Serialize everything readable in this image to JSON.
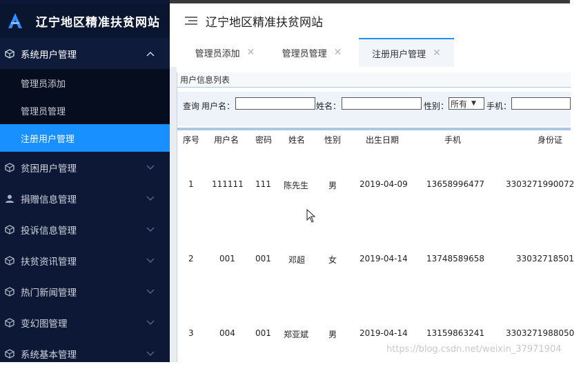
{
  "app": {
    "brand_title": "辽宁地区精准扶贫网站",
    "header_title": "辽宁地区精准扶贫网站"
  },
  "sidebar": {
    "groups": [
      {
        "label": "系统用户管理",
        "icon": "cube-icon",
        "state": "expanded"
      },
      {
        "label": "贫困用户管理",
        "icon": "cube-icon",
        "state": "collapsed"
      },
      {
        "label": "捐赠信息管理",
        "icon": "user-icon",
        "state": "collapsed"
      },
      {
        "label": "投诉信息管理",
        "icon": "cube-icon",
        "state": "collapsed"
      },
      {
        "label": "扶贫资讯管理",
        "icon": "cube-icon",
        "state": "collapsed"
      },
      {
        "label": "热门新闻管理",
        "icon": "cube-icon",
        "state": "collapsed"
      },
      {
        "label": "变幻图管理",
        "icon": "cube-icon",
        "state": "collapsed"
      },
      {
        "label": "系统基本管理",
        "icon": "cube-icon",
        "state": "collapsed"
      }
    ],
    "sub_items": [
      {
        "label": "管理员添加",
        "active": false
      },
      {
        "label": "管理员管理",
        "active": false
      },
      {
        "label": "注册用户管理",
        "active": true
      }
    ]
  },
  "tabs": [
    {
      "label": "管理员添加",
      "close": "✕",
      "active": false
    },
    {
      "label": "管理员管理",
      "close": "✕",
      "active": false
    },
    {
      "label": "注册用户管理",
      "close": "✕",
      "active": true
    }
  ],
  "panel": {
    "title": "用户信息列表",
    "search": {
      "query_label": "查询",
      "username_label": "用户名：",
      "username_value": "",
      "name_label": "姓名：",
      "name_value": "",
      "gender_label": "性别：",
      "gender_selected": "所有",
      "phone_label": "手机：",
      "phone_value": ""
    }
  },
  "table": {
    "columns": [
      "序号",
      "用户名",
      "密码",
      "姓名",
      "性别",
      "出生日期",
      "手机",
      "身份证"
    ],
    "rows": [
      [
        "1",
        "111111",
        "111",
        "陈先生",
        "男",
        "2019-04-09",
        "13658996477",
        "3303271990072"
      ],
      [
        "2",
        "001",
        "001",
        "邓超",
        "女",
        "2019-04-14",
        "13748589658",
        "33032718501"
      ],
      [
        "3",
        "004",
        "001",
        "郑亚斌",
        "男",
        "2019-04-14",
        "13159863241",
        "3303271988050"
      ]
    ]
  },
  "watermark": "https://blog.csdn.net/weixin_37971904",
  "colors": {
    "sidebar_bg": "#0c1836",
    "active_blue": "#1890ff",
    "table_line": "#a9c7e3"
  }
}
